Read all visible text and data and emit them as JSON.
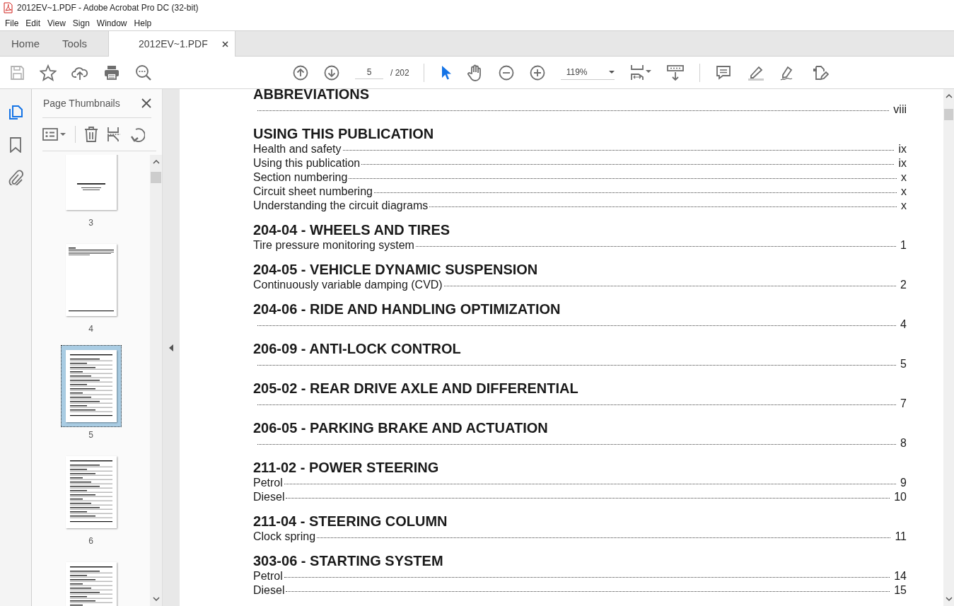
{
  "window": {
    "title": "2012EV~1.PDF - Adobe Acrobat Pro DC (32-bit)"
  },
  "menu": [
    "File",
    "Edit",
    "View",
    "Sign",
    "Window",
    "Help"
  ],
  "tabs": [
    {
      "label": "Home",
      "selected": false
    },
    {
      "label": "Tools",
      "selected": false
    },
    {
      "label": "2012EV~1.PDF",
      "selected": true
    }
  ],
  "toolbar": {
    "page_field": "5",
    "page_count": "/ 202",
    "zoom": "119%"
  },
  "sidebar": {
    "title": "Page Thumbnails",
    "thumbnails": [
      {
        "label": "3",
        "kind": "cover",
        "selected": false
      },
      {
        "label": "4",
        "kind": "text",
        "selected": false
      },
      {
        "label": "5",
        "kind": "toc",
        "selected": true
      },
      {
        "label": "6",
        "kind": "toc",
        "selected": false
      },
      {
        "kind": "toc",
        "selected": false
      }
    ]
  },
  "document": {
    "sections": [
      {
        "heading": "ABBREVIATIONS",
        "entries": [
          {
            "page": "viii"
          }
        ]
      },
      {
        "heading": "USING THIS PUBLICATION",
        "entries": [
          {
            "label": "Health and safety",
            "page": "ix"
          },
          {
            "label": "Using this publication",
            "page": "ix"
          },
          {
            "label": "Section numbering",
            "page": "x"
          },
          {
            "label": "Circuit sheet numbering",
            "page": "x"
          },
          {
            "label": "Understanding the circuit diagrams",
            "page": "x"
          }
        ]
      },
      {
        "heading": "204-04 - WHEELS AND TIRES",
        "entries": [
          {
            "label": "Tire pressure monitoring system",
            "page": "1"
          }
        ]
      },
      {
        "heading": "204-05 - VEHICLE DYNAMIC SUSPENSION",
        "entries": [
          {
            "label": "Continuously variable damping (CVD)",
            "page": "2"
          }
        ]
      },
      {
        "heading": "204-06 - RIDE AND HANDLING OPTIMIZATION",
        "entries": [
          {
            "page": "4"
          }
        ]
      },
      {
        "heading": "206-09 - ANTI-LOCK CONTROL",
        "entries": [
          {
            "page": "5"
          }
        ]
      },
      {
        "heading": "205-02 - REAR DRIVE AXLE AND DIFFERENTIAL",
        "entries": [
          {
            "page": "7"
          }
        ]
      },
      {
        "heading": "206-05 - PARKING BRAKE AND ACTUATION",
        "entries": [
          {
            "page": "8"
          }
        ]
      },
      {
        "heading": "211-02 - POWER STEERING",
        "entries": [
          {
            "label": "Petrol",
            "page": "9"
          },
          {
            "label": "Diesel",
            "page": "10"
          }
        ]
      },
      {
        "heading": "211-04 - STEERING COLUMN",
        "entries": [
          {
            "label": "Clock spring",
            "page": "11"
          }
        ]
      },
      {
        "heading": "303-06 - STARTING SYSTEM",
        "entries": [
          {
            "label": "Petrol",
            "page": "14"
          },
          {
            "label": "Diesel",
            "page": "15"
          }
        ]
      }
    ]
  }
}
